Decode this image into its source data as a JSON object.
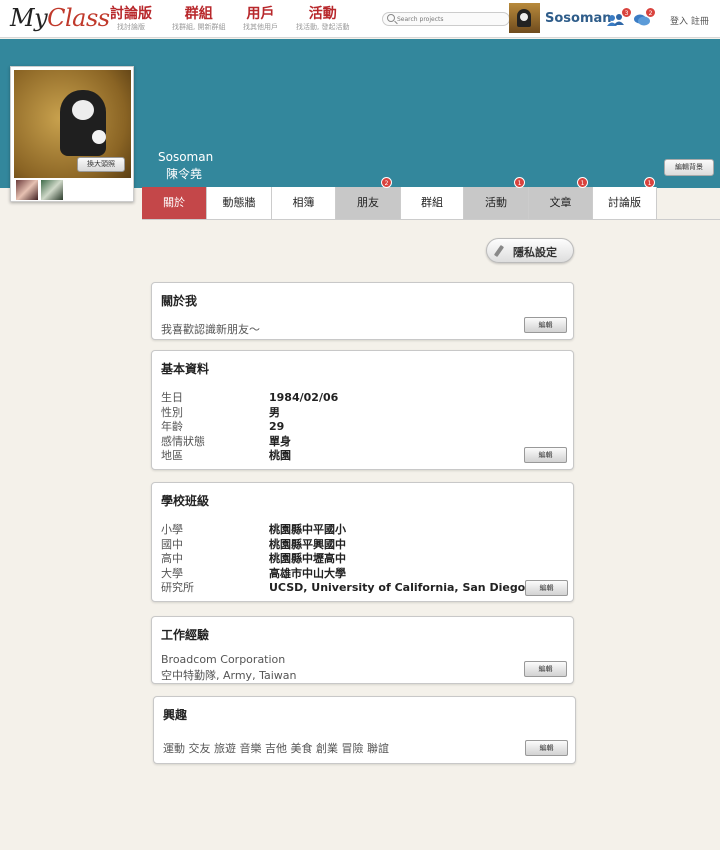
{
  "app": {
    "logo_prefix": "My",
    "logo_accent": "Class"
  },
  "nav": [
    {
      "label": "討論版",
      "sub": "找討論版"
    },
    {
      "label": "群組",
      "sub": "找群組, 開新群組"
    },
    {
      "label": "用戶",
      "sub": "找其他用戶"
    },
    {
      "label": "活動",
      "sub": "找活動, 發起活動"
    }
  ],
  "search": {
    "placeholder": "Search projects",
    "value": ""
  },
  "user": {
    "username": "Sosoman",
    "friend_requests": "3",
    "messages": "2"
  },
  "auth": {
    "login": "登入",
    "register": "註冊"
  },
  "profile": {
    "name_en": "Sosoman",
    "name_zh": "陳令堯",
    "enlarge_label": "換大頭照",
    "cover_edit_label": "編輯背景"
  },
  "tabs": [
    {
      "label": "關於",
      "badge": ""
    },
    {
      "label": "動態牆",
      "badge": ""
    },
    {
      "label": "相簿",
      "badge": ""
    },
    {
      "label": "朋友",
      "badge": "2"
    },
    {
      "label": "群組",
      "badge": ""
    },
    {
      "label": "活動",
      "badge": "1"
    },
    {
      "label": "文章",
      "badge": "1"
    },
    {
      "label": "討論版",
      "badge": "1"
    }
  ],
  "privacy_label": "隱私設定",
  "edit_label": "編輯",
  "about": {
    "title": "關於我",
    "text": "我喜歡認識新朋友～"
  },
  "basic": {
    "title": "基本資料",
    "fields": [
      {
        "label": "生日",
        "value": "1984/02/06"
      },
      {
        "label": "性別",
        "value": "男"
      },
      {
        "label": "年齡",
        "value": "29"
      },
      {
        "label": "感情狀態",
        "value": "單身"
      },
      {
        "label": "地區",
        "value": "桃園"
      }
    ]
  },
  "school": {
    "title": "學校班級",
    "fields": [
      {
        "label": "小學",
        "value": "桃園縣中平國小"
      },
      {
        "label": "國中",
        "value": "桃園縣平興國中"
      },
      {
        "label": "高中",
        "value": "桃園縣中壢高中"
      },
      {
        "label": "大學",
        "value": "高雄市中山大學"
      },
      {
        "label": "研究所",
        "value": "UCSD, University of California, San Diego"
      }
    ]
  },
  "work": {
    "title": "工作經驗",
    "lines": [
      "Broadcom Corporation",
      "空中特勤隊, Army, Taiwan"
    ]
  },
  "interests": {
    "title": "興趣",
    "text": "運動 交友 旅遊 音樂 吉他 美食 創業 冒險 聯誼"
  }
}
